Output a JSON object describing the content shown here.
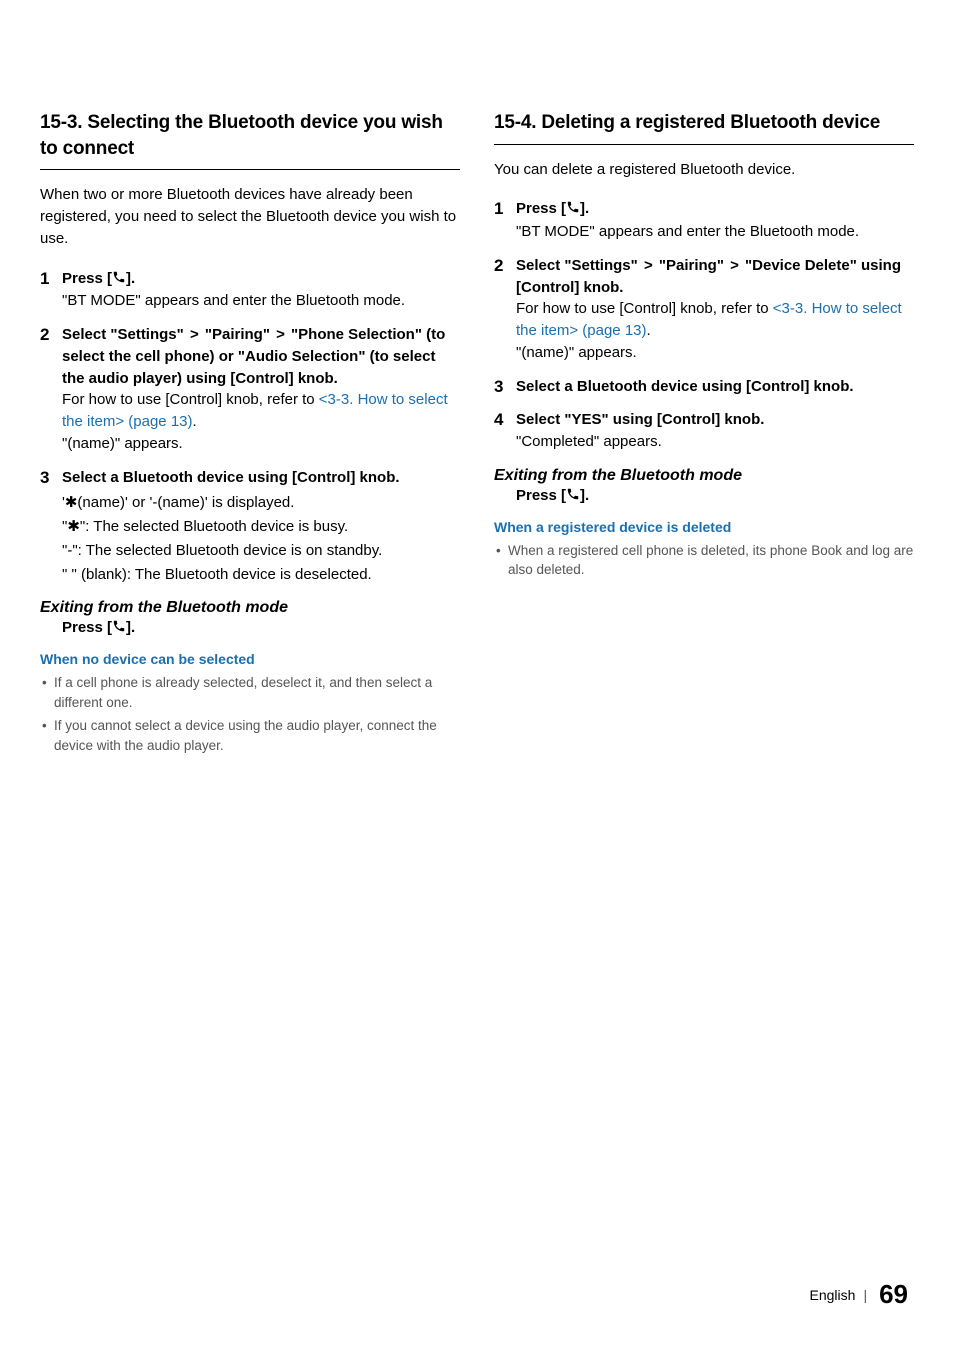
{
  "left": {
    "title": "15-3.  Selecting the Bluetooth device you wish to connect",
    "intro": "When two or more Bluetooth devices have already been registered, you need to select the Bluetooth device you wish to use.",
    "steps": [
      {
        "head_pre": "Press [",
        "head_post": "].",
        "body": "\"BT MODE\" appears and enter the Bluetooth mode."
      },
      {
        "head_parts": [
          "Select \"Settings\" ",
          " \"Pairing\" ",
          " \"Phone Selection\" (to select the cell phone) or \"Audio Selection\" (to select the audio player) using [Control] knob."
        ],
        "body_pre": "For how to use [Control] knob, refer to ",
        "link": "<3-3. How to select the item> (page 13)",
        "body_post": ".",
        "body2": "\"(name)\" appears."
      },
      {
        "head": "Select a Bluetooth device using [Control] knob.",
        "sub": [
          "'✱(name)' or '-(name)' is displayed.",
          "\"✱\": The selected Bluetooth device is busy.",
          "\"-\": The selected Bluetooth device is on standby.",
          "\"  \" (blank): The Bluetooth device is deselected."
        ]
      }
    ],
    "exit_title": "Exiting from the Bluetooth mode",
    "exit_body_pre": "Press [",
    "exit_body_post": "].",
    "note_title": "When no device can be selected",
    "notes": [
      "If a cell phone is already selected, deselect it, and then select a different one.",
      "If you cannot select a device using the audio player, connect the device with the audio player."
    ]
  },
  "right": {
    "title": "15-4.  Deleting a registered Bluetooth device",
    "intro": "You can delete a registered Bluetooth device.",
    "steps": [
      {
        "head_pre": "Press [",
        "head_post": "].",
        "body": "\"BT MODE\" appears and enter the Bluetooth mode."
      },
      {
        "head_parts": [
          "Select \"Settings\" ",
          " \"Pairing\" ",
          " \"Device Delete\" using [Control] knob."
        ],
        "body_pre": "For how to use [Control] knob, refer to ",
        "link": "<3-3. How to select the item> (page 13)",
        "body_post": ".",
        "body2": "\"(name)\" appears."
      },
      {
        "head": "Select a Bluetooth device using [Control] knob."
      },
      {
        "head": "Select \"YES\" using [Control] knob.",
        "body": "\"Completed\" appears."
      }
    ],
    "exit_title": "Exiting from the Bluetooth mode",
    "exit_body_pre": "Press [",
    "exit_body_post": "].",
    "note_title": "When a registered device is deleted",
    "notes": [
      "When a registered cell phone is deleted, its phone Book and log are also deleted."
    ]
  },
  "footer": {
    "lang": "English",
    "page": "69"
  }
}
